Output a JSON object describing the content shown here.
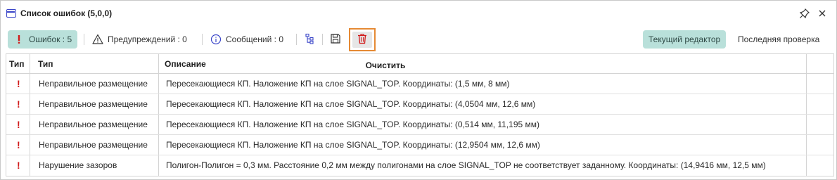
{
  "window": {
    "title": "Список ошибок (5,0,0)"
  },
  "toolbar": {
    "errors_label": "Ошибок : 5",
    "warnings_label": "Предупреждений : 0",
    "messages_label": "Сообщений : 0",
    "current_editor_label": "Текущий редактор",
    "last_check_label": "Последняя проверка",
    "clear_tooltip": "Очистить"
  },
  "table": {
    "columns": [
      "Тип",
      "Тип",
      "Описание"
    ],
    "rows": [
      {
        "severity": "!",
        "type": "Неправильное размещение",
        "description": "Пересекающиеся КП. Наложение КП на слое SIGNAL_TOP. Координаты: (1,5 мм, 8 мм)"
      },
      {
        "severity": "!",
        "type": "Неправильное размещение",
        "description": "Пересекающиеся КП. Наложение КП на слое SIGNAL_TOP. Координаты: (4,0504 мм, 12,6 мм)"
      },
      {
        "severity": "!",
        "type": "Неправильное размещение",
        "description": "Пересекающиеся КП. Наложение КП на слое SIGNAL_TOP. Координаты: (0,514 мм, 11,195 мм)"
      },
      {
        "severity": "!",
        "type": "Неправильное размещение",
        "description": "Пересекающиеся КП. Наложение КП на слое SIGNAL_TOP. Координаты: (12,9504 мм, 12,6 мм)"
      },
      {
        "severity": "!",
        "type": "Нарушение зазоров",
        "description": "Полигон-Полигон = 0,3 мм. Расстояние 0,2 мм между полигонами на слое SIGNAL_TOP не соответствует заданному. Координаты: (14,9416 мм, 12,5 мм)"
      }
    ]
  },
  "colors": {
    "accent_active": "#b9e0da",
    "error_red": "#d11a1a",
    "highlight_orange": "#e58a34",
    "title_icon_blue": "#3a45c8"
  },
  "icons": [
    "window-icon",
    "pin-icon",
    "close-icon",
    "error-icon",
    "warning-icon",
    "info-icon",
    "tree-icon",
    "save-icon",
    "trash-icon"
  ]
}
